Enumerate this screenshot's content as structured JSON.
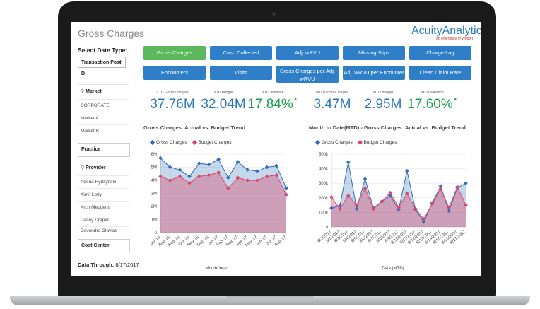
{
  "app": {
    "title": "Gross Charges",
    "logo": "AcuityAnalytics",
    "logo_sub": "an enterprise of Weport"
  },
  "sidebar": {
    "date_type_label": "Select Date Type:",
    "date_type_value": "Transaction Post D",
    "market": {
      "label": "Market",
      "items": [
        "CORPORATE",
        "Market A",
        "Market B"
      ]
    },
    "practice": {
      "label": "Practice"
    },
    "provider": {
      "label": "Provider",
      "items": [
        "Adena Rydzynski",
        "Aimil Lofty",
        "Arch Meugens",
        "Dacey Draper",
        "Devondra Glavias"
      ]
    },
    "cost_center": {
      "label": "Cost Center"
    },
    "data_through_label": "Data Through:",
    "data_through_value": "8/17/2017"
  },
  "buttons": {
    "row1": [
      "Gross Charges",
      "Cash Collected",
      "Adj. wRVU",
      "Missing Slips",
      "Charge Lag"
    ],
    "row2": [
      "Encounters",
      "Visits",
      "Gross Charges per Adj. wRVU",
      "Adj. wRVU per Encounter",
      "Clean Claim Rate"
    ]
  },
  "kpis": {
    "ytd_gross_label": "YTD Gross Charges",
    "ytd_gross": "37.76M",
    "ytd_budget_label": "YTD Budget",
    "ytd_budget": "32.04M",
    "ytd_variance_label": "YTD Variance",
    "ytd_variance": "17.84%",
    "mtd_gross_label": "MTD Gross Charges",
    "mtd_gross": "3.47M",
    "mtd_budget_label": "MTD Budget",
    "mtd_budget": "2.95M",
    "mtd_variance_label": "MTD Variance",
    "mtd_variance": "17.60%"
  },
  "colors": {
    "gross": "#2f6fb7",
    "budget": "#d9446a",
    "accent_green": "#5cb85c",
    "accent_blue": "#2f7fc8"
  },
  "chart_data": [
    {
      "type": "area",
      "title": "Gross Charges: Actual vs. Budget Trend",
      "xlabel": "Month-Year",
      "ylabel": "",
      "categories": [
        "Jul-16",
        "Aug-16",
        "Sep-16",
        "Oct-16",
        "Nov-16",
        "Dec-16",
        "Jan-17",
        "Feb-17",
        "Mar-17",
        "Apr-17",
        "May-17",
        "Jun-17",
        "Jul-17",
        "Aug-17"
      ],
      "series": [
        {
          "name": "Gross Charges",
          "values": [
            5.7,
            5.0,
            4.8,
            4.3,
            5.3,
            5.2,
            5.6,
            4.2,
            5.4,
            4.8,
            4.7,
            5.0,
            5.1,
            3.4
          ]
        },
        {
          "name": "Budget Charges",
          "values": [
            4.3,
            4.0,
            4.3,
            3.8,
            4.3,
            4.4,
            4.6,
            3.4,
            4.2,
            4.0,
            4.0,
            4.3,
            4.4,
            2.9
          ]
        }
      ],
      "ylim": [
        0,
        6
      ],
      "yticks": [
        "0",
        "1M",
        "2M",
        "3M",
        "4M",
        "5M",
        "6M"
      ],
      "grid": true,
      "legend": "top-left"
    },
    {
      "type": "area",
      "title": "Month to Date(MTD) - Gross Charges: Actual vs. Budget Trend",
      "xlabel": "Date (MTD)",
      "ylabel": "",
      "categories": [
        "8/1/2017",
        "8/2/2017",
        "8/3/2017",
        "8/4/2017",
        "8/5/2017",
        "8/6/2017",
        "8/7/2017",
        "8/8/2017",
        "8/9/2017",
        "8/10/2017",
        "8/11/2017",
        "8/12/2017",
        "8/13/2017",
        "8/14/2017",
        "8/15/2017",
        "8/16/2017",
        "8/17/2017"
      ],
      "series": [
        {
          "name": "Gross Charges",
          "values": [
            130,
            145,
            445,
            125,
            330,
            130,
            175,
            215,
            120,
            385,
            120,
            35,
            165,
            280,
            110,
            270,
            300
          ]
        },
        {
          "name": "Budget Charges",
          "values": [
            205,
            125,
            215,
            150,
            265,
            125,
            175,
            235,
            135,
            230,
            125,
            55,
            160,
            260,
            135,
            275,
            150
          ]
        }
      ],
      "ylim": [
        0,
        500
      ],
      "yticks": [
        "0",
        "100k",
        "200k",
        "300k",
        "400k",
        "500k"
      ],
      "grid": true,
      "legend": "top-left"
    }
  ]
}
